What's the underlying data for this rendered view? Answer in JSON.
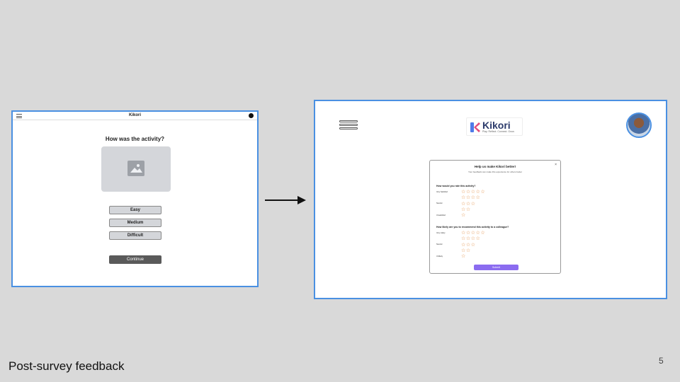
{
  "slide": {
    "caption": "Post-survey feedback",
    "page_number": "5"
  },
  "left_wireframe": {
    "app_title": "Kikori",
    "question": "How was the activity?",
    "options": [
      "Easy",
      "Medium",
      "Difficult"
    ],
    "continue_label": "Continue",
    "icons": {
      "menu": "hamburger-icon",
      "profile": "profile-dot-icon",
      "image": "image-placeholder-icon"
    }
  },
  "right_mockup": {
    "brand": "Kikori",
    "tagline": "Play. Reflect. Connect. Grow.",
    "modal": {
      "close": "×",
      "title": "Help us make Kikori better!",
      "subtitle": "Your feedback can make this experience for others better",
      "q1": "How would you rate this activity?",
      "q1_ratings": [
        {
          "label": "Very Satisfied",
          "stars": 5
        },
        {
          "label": "",
          "stars": 4
        },
        {
          "label": "Neutral",
          "stars": 3
        },
        {
          "label": "",
          "stars": 2
        },
        {
          "label": "Unsatisfied",
          "stars": 1
        }
      ],
      "q2": "How likely are you to recommend this activity to a colleague?",
      "q2_ratings": [
        {
          "label": "Very Likely",
          "stars": 5
        },
        {
          "label": "",
          "stars": 4
        },
        {
          "label": "Neutral",
          "stars": 3
        },
        {
          "label": "",
          "stars": 2
        },
        {
          "label": "Unlikely",
          "stars": 1
        }
      ],
      "submit_label": "Submit"
    },
    "colors": {
      "accent": "#8b6cf0",
      "star": "#e08a3c",
      "frame_border": "#4a90e2"
    }
  }
}
